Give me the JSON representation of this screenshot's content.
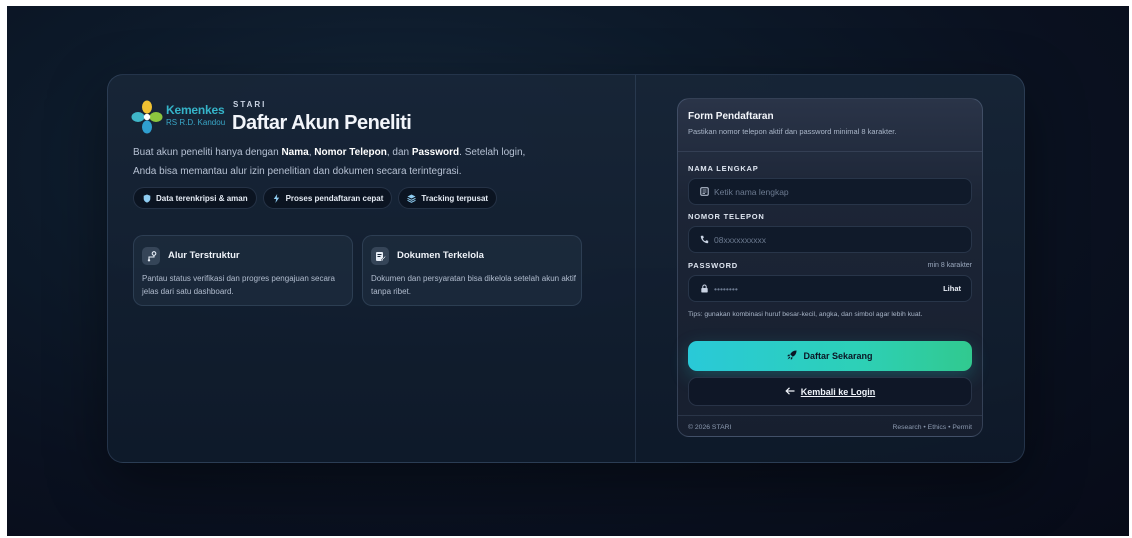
{
  "brand": {
    "logo_line1": "Kemenkes",
    "logo_line2": "RS R.D. Kandou",
    "eyebrow": "STARI",
    "title": "Daftar Akun Peneliti"
  },
  "intro": {
    "part1": "Buat akun peneliti hanya dengan ",
    "bold1": "Nama",
    "part2": ", ",
    "bold2": "Nomor Telepon",
    "part3": ", dan ",
    "bold3": "Password",
    "part4": ". Setelah login, Anda bisa memantau alur izin penelitian dan dokumen secara terintegrasi."
  },
  "pills": [
    {
      "icon": "shield-icon",
      "label": "Data terenkripsi & aman"
    },
    {
      "icon": "lightning-icon",
      "label": "Proses pendaftaran cepat"
    },
    {
      "icon": "layers-icon",
      "label": "Tracking terpusat"
    }
  ],
  "features": [
    {
      "icon": "flow-icon",
      "title": "Alur Terstruktur",
      "desc": "Pantau status verifikasi dan progres pengajuan secara jelas dari satu dashboard."
    },
    {
      "icon": "document-edit-icon",
      "title": "Dokumen Terkelola",
      "desc": "Dokumen dan persyaratan bisa dikelola setelah akun aktif tanpa ribet."
    }
  ],
  "form": {
    "title": "Form Pendaftaran",
    "subtitle": "Pastikan nomor telepon aktif dan password minimal 8 karakter.",
    "name_label": "NAMA LENGKAP",
    "name_placeholder": "Ketik nama lengkap",
    "phone_label": "NOMOR TELEPON",
    "phone_placeholder": "08xxxxxxxxxx",
    "password_label": "PASSWORD",
    "password_hint": "min 8 karakter",
    "password_placeholder": "••••••••",
    "show_label": "Lihat",
    "tips": "Tips: gunakan kombinasi huruf besar-kecil, angka, dan simbol agar lebih kuat.",
    "submit_label": "Daftar Sekarang",
    "back_label": "Kembali ke Login",
    "footer_left": "© 2026 STARI",
    "footer_right": "Research • Ethics • Permit"
  },
  "colors": {
    "accent_start": "#29c9d8",
    "accent_end": "#31c98f",
    "logo": "#35b4c9"
  }
}
